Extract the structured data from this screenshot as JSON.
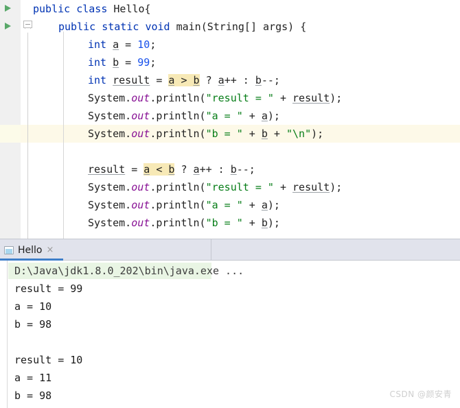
{
  "editor": {
    "language": "java",
    "run_markers": [
      {
        "name": "run-class-marker",
        "line": 0
      },
      {
        "name": "run-main-marker",
        "line": 1
      }
    ],
    "current_line_index": 7,
    "colors": {
      "keyword": "#0033b3",
      "number": "#1750eb",
      "string": "#067d17",
      "static_field": "#871094",
      "selection_highlight": "#f7e9b6",
      "current_line_highlight": "#fdf9e8",
      "gutter": "#f0f0f0"
    },
    "lines": [
      {
        "indent": 48,
        "tokens": [
          {
            "t": "public",
            "c": "kw"
          },
          {
            "t": " ",
            "c": "plain"
          },
          {
            "t": "class",
            "c": "kw"
          },
          {
            "t": " Hello{",
            "c": "plain"
          }
        ]
      },
      {
        "indent": 85,
        "tokens": [
          {
            "t": "public",
            "c": "kw"
          },
          {
            "t": " ",
            "c": "plain"
          },
          {
            "t": "static",
            "c": "kw"
          },
          {
            "t": " ",
            "c": "plain"
          },
          {
            "t": "void",
            "c": "kw"
          },
          {
            "t": " ",
            "c": "plain"
          },
          {
            "t": "main",
            "c": "mname"
          },
          {
            "t": "(String[] args) {",
            "c": "plain"
          }
        ]
      },
      {
        "indent": 128,
        "tokens": [
          {
            "t": "int",
            "c": "kw"
          },
          {
            "t": " ",
            "c": "plain"
          },
          {
            "t": "a",
            "c": "ul"
          },
          {
            "t": " = ",
            "c": "plain"
          },
          {
            "t": "10",
            "c": "num"
          },
          {
            "t": ";",
            "c": "plain"
          }
        ]
      },
      {
        "indent": 128,
        "tokens": [
          {
            "t": "int",
            "c": "kw"
          },
          {
            "t": " ",
            "c": "plain"
          },
          {
            "t": "b",
            "c": "ul"
          },
          {
            "t": " = ",
            "c": "plain"
          },
          {
            "t": "99",
            "c": "num"
          },
          {
            "t": ";",
            "c": "plain"
          }
        ]
      },
      {
        "indent": 128,
        "tokens": [
          {
            "t": "int",
            "c": "kw"
          },
          {
            "t": " ",
            "c": "plain"
          },
          {
            "t": "result",
            "c": "ul"
          },
          {
            "t": " = ",
            "c": "plain"
          },
          {
            "t": "a",
            "c": "ul sel"
          },
          {
            "t": " > ",
            "c": "plain sel"
          },
          {
            "t": "b",
            "c": "ul sel"
          },
          {
            "t": " ? ",
            "c": "plain"
          },
          {
            "t": "a",
            "c": "ul"
          },
          {
            "t": "++ : ",
            "c": "plain"
          },
          {
            "t": "b",
            "c": "ul"
          },
          {
            "t": "--;",
            "c": "plain"
          }
        ]
      },
      {
        "indent": 128,
        "tokens": [
          {
            "t": "System.",
            "c": "plain"
          },
          {
            "t": "out",
            "c": "fld"
          },
          {
            "t": ".println(",
            "c": "plain"
          },
          {
            "t": "\"result = \"",
            "c": "str"
          },
          {
            "t": " + ",
            "c": "plain"
          },
          {
            "t": "result",
            "c": "ul"
          },
          {
            "t": ");",
            "c": "plain"
          }
        ]
      },
      {
        "indent": 128,
        "tokens": [
          {
            "t": "System.",
            "c": "plain"
          },
          {
            "t": "out",
            "c": "fld"
          },
          {
            "t": ".println(",
            "c": "plain"
          },
          {
            "t": "\"a = \"",
            "c": "str"
          },
          {
            "t": " + ",
            "c": "plain"
          },
          {
            "t": "a",
            "c": "ul"
          },
          {
            "t": ");",
            "c": "plain"
          }
        ]
      },
      {
        "indent": 128,
        "tokens": [
          {
            "t": "System.",
            "c": "plain"
          },
          {
            "t": "out",
            "c": "fld"
          },
          {
            "t": ".println(",
            "c": "plain"
          },
          {
            "t": "\"b = \"",
            "c": "str"
          },
          {
            "t": " + ",
            "c": "plain"
          },
          {
            "t": "b",
            "c": "ul"
          },
          {
            "t": " + ",
            "c": "plain"
          },
          {
            "t": "\"\\n\"",
            "c": "str"
          },
          {
            "t": ");",
            "c": "plain"
          }
        ]
      },
      {
        "indent": 128,
        "tokens": []
      },
      {
        "indent": 128,
        "tokens": [
          {
            "t": "result",
            "c": "ul"
          },
          {
            "t": " = ",
            "c": "plain"
          },
          {
            "t": "a",
            "c": "ul sel"
          },
          {
            "t": " < ",
            "c": "plain sel"
          },
          {
            "t": "b",
            "c": "ul sel"
          },
          {
            "t": " ? ",
            "c": "plain"
          },
          {
            "t": "a",
            "c": "ul"
          },
          {
            "t": "++ : ",
            "c": "plain"
          },
          {
            "t": "b",
            "c": "ul"
          },
          {
            "t": "--;",
            "c": "plain"
          }
        ]
      },
      {
        "indent": 128,
        "tokens": [
          {
            "t": "System.",
            "c": "plain"
          },
          {
            "t": "out",
            "c": "fld"
          },
          {
            "t": ".println(",
            "c": "plain"
          },
          {
            "t": "\"result = \"",
            "c": "str"
          },
          {
            "t": " + ",
            "c": "plain"
          },
          {
            "t": "result",
            "c": "ul"
          },
          {
            "t": ");",
            "c": "plain"
          }
        ]
      },
      {
        "indent": 128,
        "tokens": [
          {
            "t": "System.",
            "c": "plain"
          },
          {
            "t": "out",
            "c": "fld"
          },
          {
            "t": ".println(",
            "c": "plain"
          },
          {
            "t": "\"a = \"",
            "c": "str"
          },
          {
            "t": " + ",
            "c": "plain"
          },
          {
            "t": "a",
            "c": "ul"
          },
          {
            "t": ");",
            "c": "plain"
          }
        ]
      },
      {
        "indent": 128,
        "tokens": [
          {
            "t": "System.",
            "c": "plain"
          },
          {
            "t": "out",
            "c": "fld"
          },
          {
            "t": ".println(",
            "c": "plain"
          },
          {
            "t": "\"b = \"",
            "c": "str"
          },
          {
            "t": " + ",
            "c": "plain"
          },
          {
            "t": "b",
            "c": "ul"
          },
          {
            "t": ");",
            "c": "plain"
          }
        ]
      }
    ]
  },
  "console": {
    "tab": {
      "label": "Hello",
      "icon": "console-icon",
      "close_label": "×",
      "active": true,
      "active_underline_color": "#3e7ec8"
    },
    "command_line": "D:\\Java\\jdk1.8.0_202\\bin\\java.exe ...",
    "output_lines": [
      "result = 99",
      "a = 10",
      "b = 98",
      "",
      "result = 10",
      "a = 11",
      "b = 98"
    ]
  },
  "watermark": {
    "text": "CSDN @颜安青"
  }
}
